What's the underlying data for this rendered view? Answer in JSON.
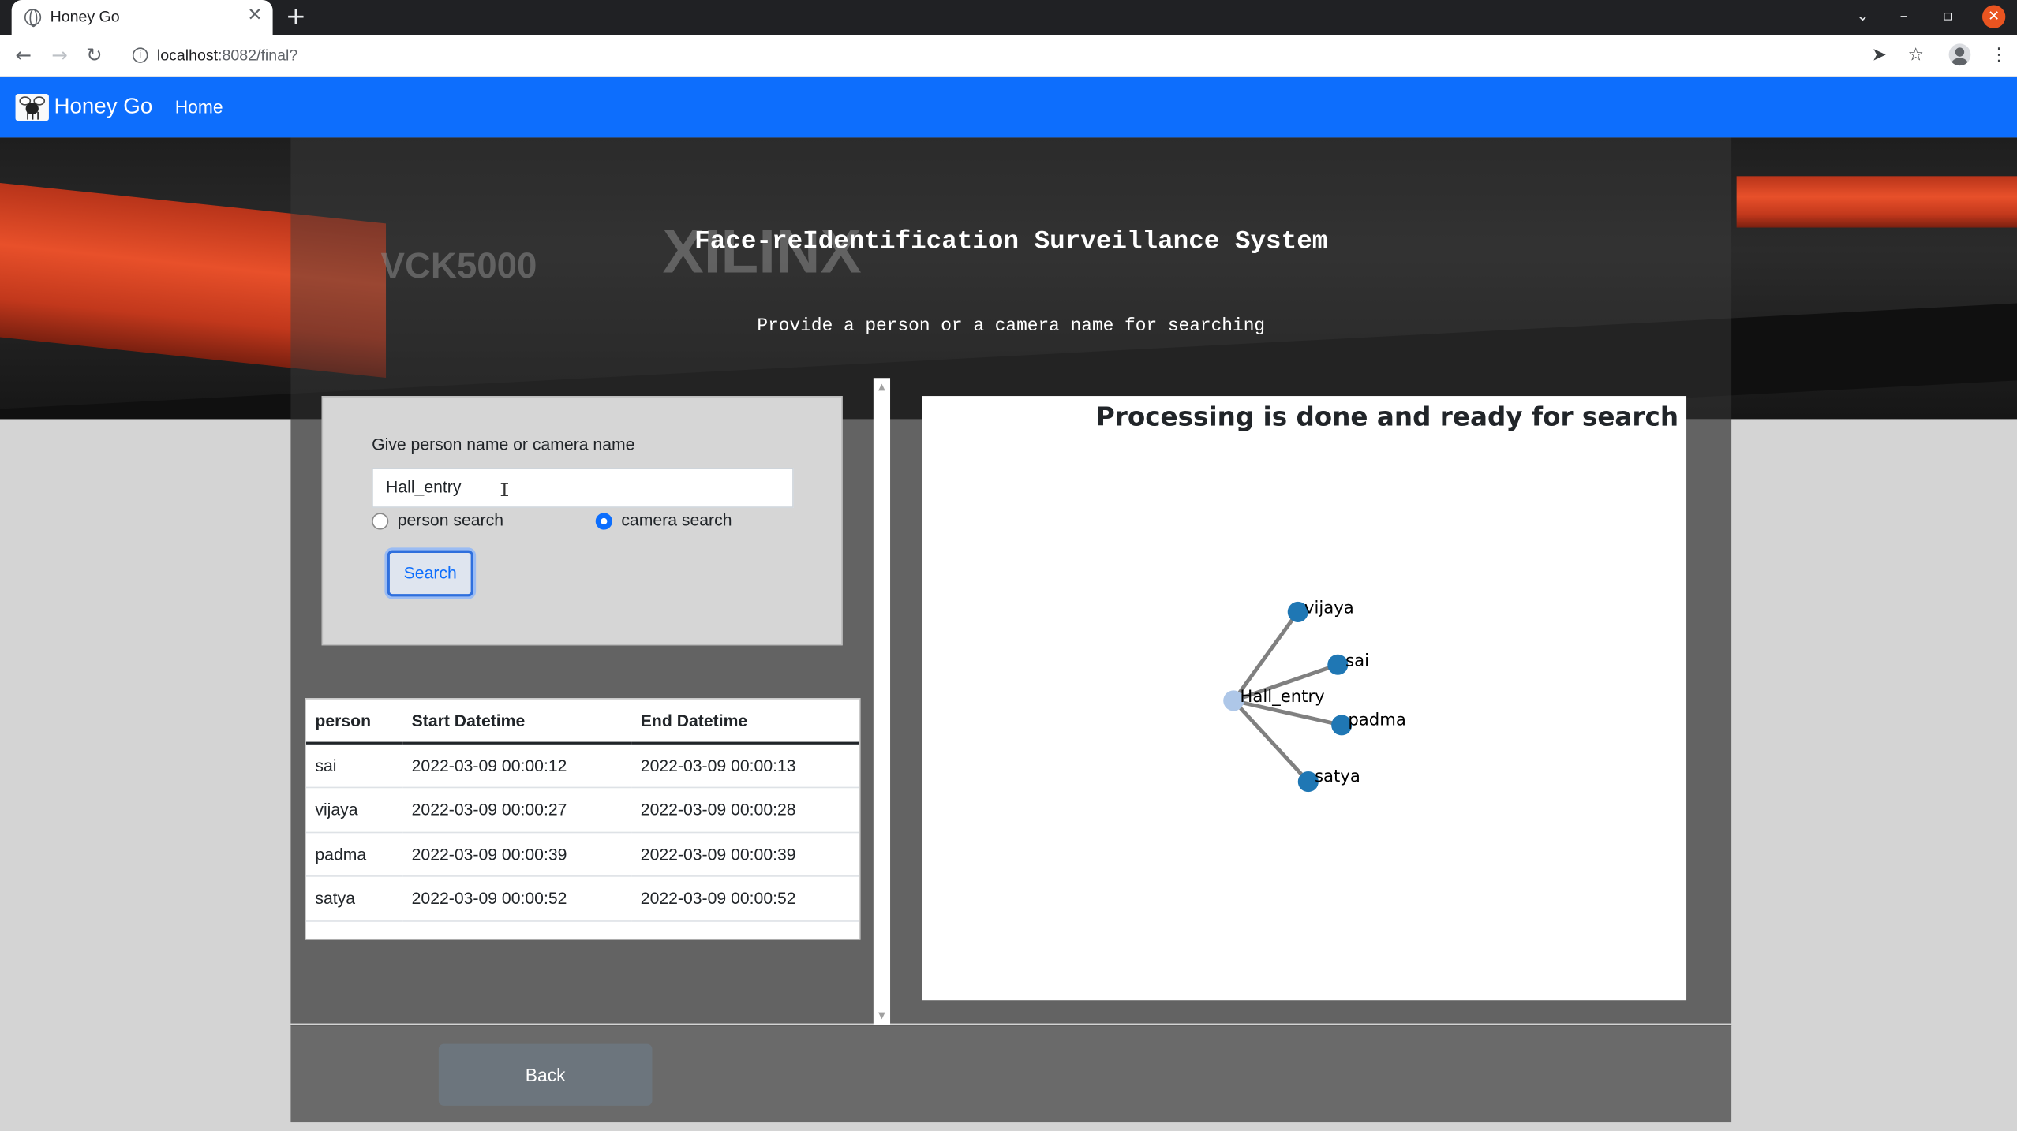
{
  "browser": {
    "tab_title": "Honey Go",
    "url_host": "localhost",
    "url_rest": ":8082/final?"
  },
  "navbar": {
    "brand": "Honey Go",
    "home": "Home"
  },
  "hero": {
    "bg_text_model": "VCK5000",
    "bg_text_brand": "XILINX",
    "title": "Face-reIdentification Surveillance System",
    "subtitle": "Provide a person or a camera name for searching"
  },
  "search": {
    "label": "Give person name or camera name",
    "value": "Hall_entry",
    "radio_person": "person search",
    "radio_camera": "camera search",
    "selected": "camera search",
    "button": "Search"
  },
  "table": {
    "headers": [
      "person",
      "Start Datetime",
      "End Datetime"
    ],
    "rows": [
      [
        "sai",
        "2022-03-09 00:00:12",
        "2022-03-09 00:00:13"
      ],
      [
        "vijaya",
        "2022-03-09 00:00:27",
        "2022-03-09 00:00:28"
      ],
      [
        "padma",
        "2022-03-09 00:00:39",
        "2022-03-09 00:00:39"
      ],
      [
        "satya",
        "2022-03-09 00:00:52",
        "2022-03-09 00:00:52"
      ]
    ]
  },
  "graph": {
    "title": "Processing is done and ready for search",
    "center": "Hall_entry",
    "nodes": [
      "vijaya",
      "sai",
      "padma",
      "satya"
    ],
    "colors": {
      "center": "#aec7e8",
      "leaf": "#1f77b4",
      "edge": "#808080"
    }
  },
  "footer": {
    "back": "Back"
  },
  "colors": {
    "navbar": "#0d6efd",
    "accent_stripe": "#e8502a"
  }
}
